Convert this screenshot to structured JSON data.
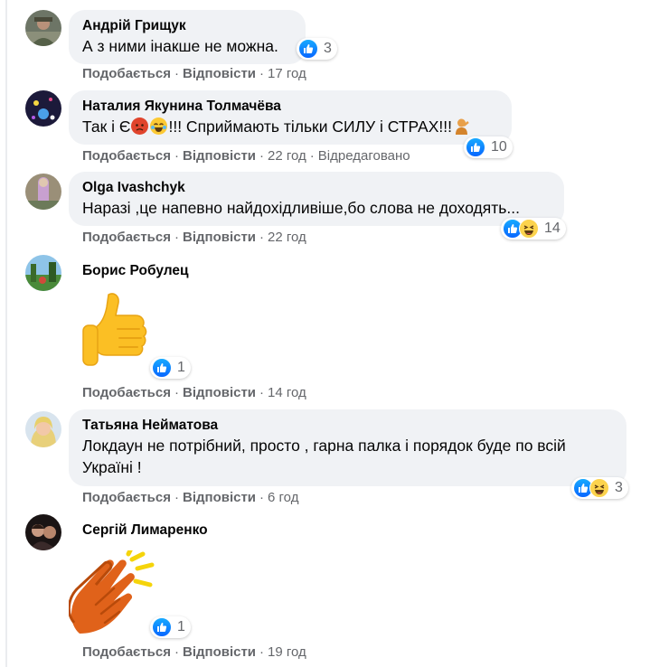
{
  "top_clipped": "Подобається · Відповісти",
  "comments": [
    {
      "author": "Андрій Грищук",
      "text": "А з ними інакше не можна.",
      "reactions": {
        "types": [
          "like"
        ],
        "count": "3"
      },
      "actions": {
        "like": "Подобається",
        "reply": "Відповісти",
        "time": "17 год",
        "edited": ""
      }
    },
    {
      "author": "Наталия Якунина Толмачёва",
      "text_before": "Так і Є",
      "text_after": "!!! Сприймають тільки СИЛУ і СТРАХ!!!",
      "inline_emojis": [
        "angry-face-icon",
        "crying-laughing-face-icon",
        "person-gesturing-icon"
      ],
      "reactions": {
        "types": [
          "like"
        ],
        "count": "10"
      },
      "actions": {
        "like": "Подобається",
        "reply": "Відповісти",
        "time": "22 год",
        "edited": "Відредаговано"
      }
    },
    {
      "author": "Olga Ivashchyk",
      "text": "Наразі ,це напевно найдохідливіше,бо слова не доходять...",
      "reactions": {
        "types": [
          "like",
          "haha"
        ],
        "count": "14"
      },
      "actions": {
        "like": "Подобається",
        "reply": "Відповісти",
        "time": "22 год",
        "edited": ""
      }
    },
    {
      "author": "Борис Робулец",
      "sticker": "thumbs-up-sticker",
      "reactions": {
        "types": [
          "like"
        ],
        "count": "1"
      },
      "actions": {
        "like": "Подобається",
        "reply": "Відповісти",
        "time": "14 год",
        "edited": ""
      }
    },
    {
      "author": "Татьяна Нейматова",
      "text": "Локдаун не потрібний, просто , гарна палка і порядок буде по всій Україні !",
      "reactions": {
        "types": [
          "like",
          "haha"
        ],
        "count": "3"
      },
      "actions": {
        "like": "Подобається",
        "reply": "Відповісти",
        "time": "6 год",
        "edited": ""
      }
    },
    {
      "author": "Сергій Лимаренко",
      "sticker": "clapping-hands-sticker",
      "reactions": {
        "types": [
          "like"
        ],
        "count": "1"
      },
      "actions": {
        "like": "Подобається",
        "reply": "Відповісти",
        "time": "19 год",
        "edited": ""
      }
    }
  ],
  "colors": {
    "bubble": "#f0f2f5",
    "meta": "#65676b",
    "like_blue": "#0866ff",
    "text": "#050505"
  }
}
